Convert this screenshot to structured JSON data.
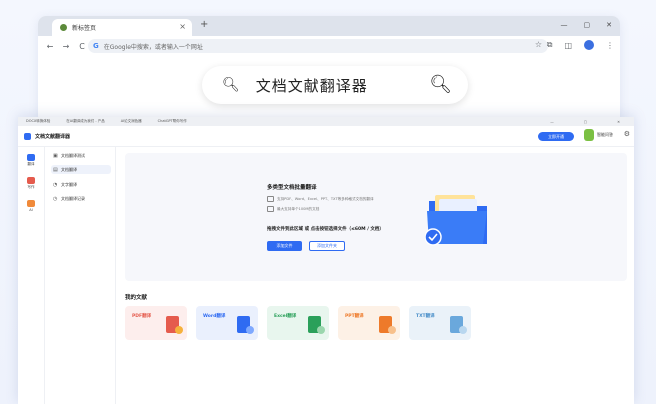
{
  "browser": {
    "tab_title": "新标签页",
    "tab_close": "×",
    "tab_add": "+",
    "window_controls": [
      "—",
      "▢",
      "✕"
    ],
    "back": "←",
    "forward": "→",
    "reload": "C",
    "omnibox_mark": "G",
    "omnibox_placeholder": "在Google中搜索，或者输入一个网址",
    "star": "☆",
    "toolbar_icons": [
      "⧉",
      "◫"
    ],
    "menu": "⋮",
    "search_pill_text": "文档文献翻译器",
    "search_icon_left": "🔍︎",
    "search_icon_right": "🔍︎"
  },
  "app": {
    "tabstrip": [
      "DOCX转换体验",
      "在AI翻译成为我们 - 产品",
      "AI论文润色器",
      "ChatGPT帮你写作"
    ],
    "window_controls": [
      "—",
      "▢",
      "✕"
    ],
    "title": "文档文献翻译器",
    "cta_label": "立即开通",
    "assistant_label": "智能问答",
    "settings": "⚙",
    "rail": [
      {
        "label": "翻译",
        "color": "#2f6bf2"
      },
      {
        "label": "写作",
        "color": "#e55b4d"
      },
      {
        "label": "AI",
        "color": "#f08a3a"
      }
    ],
    "subnav": [
      {
        "icon": "▣",
        "label": "文档翻译测试"
      },
      {
        "icon": "▤",
        "label": "文档翻译",
        "active": true
      },
      {
        "icon": "◔",
        "label": "文字翻译"
      },
      {
        "icon": "◷",
        "label": "文档翻译记录"
      }
    ],
    "panel": {
      "title": "多类型文档批量翻译",
      "features": [
        "支持PDF、Word、Excel、PPT、TXT等多种格式文档的翻译",
        "最大支持单个100M的文档"
      ],
      "drop_hint": "拖拽文件到此区域 或 点击按钮选择文件（≤60M / 文档）",
      "primary_button": "添加文件",
      "secondary_button": "添加文件夹"
    },
    "section_title": "我的文献",
    "cards": [
      {
        "label": "PDF翻译",
        "bg": "#fdeeed",
        "fg": "#e55b4d"
      },
      {
        "label": "Word翻译",
        "bg": "#eaf0fd",
        "fg": "#2f6bf2"
      },
      {
        "label": "Excel翻译",
        "bg": "#e8f6ee",
        "fg": "#2aa05a"
      },
      {
        "label": "PPT翻译",
        "bg": "#fdf1e6",
        "fg": "#ee7a2a"
      },
      {
        "label": "TXT翻译",
        "bg": "#eaf2f9",
        "fg": "#4a8fc9"
      }
    ]
  }
}
